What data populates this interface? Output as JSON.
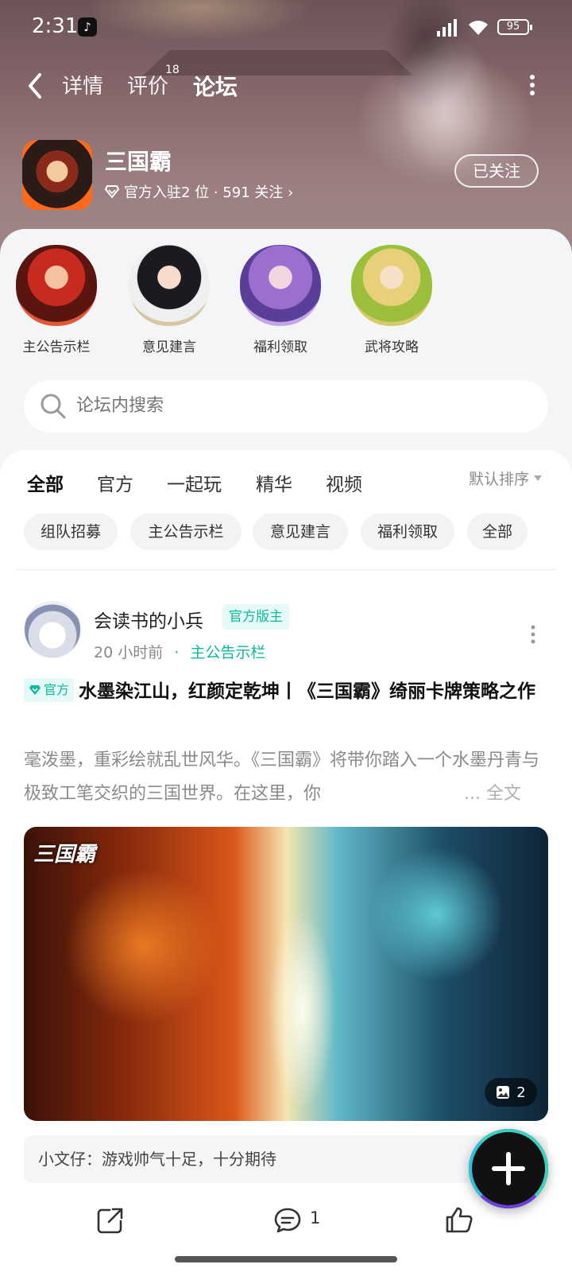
{
  "status_bar": {
    "time": "2:31",
    "battery": "95"
  },
  "nav": {
    "tabs": [
      {
        "label": "详情"
      },
      {
        "label": "评价",
        "badge": "18"
      },
      {
        "label": "论坛"
      }
    ],
    "active_tab": "论坛"
  },
  "game": {
    "title": "三国霸",
    "meta": "官方入驻2 位 · 591 关注 ›",
    "follow_label": "已关注"
  },
  "quick_links": [
    {
      "label": "主公告示栏"
    },
    {
      "label": "意见建言"
    },
    {
      "label": "福利领取"
    },
    {
      "label": "武将攻略"
    }
  ],
  "search": {
    "placeholder": "论坛内搜索"
  },
  "category_tabs": [
    "全部",
    "官方",
    "一起玩",
    "精华",
    "视频"
  ],
  "sort_label": "默认排序",
  "chips": [
    "组队招募",
    "主公告示栏",
    "意见建言",
    "福利领取",
    "全部"
  ],
  "post": {
    "author": "会读书的小兵",
    "author_badge": "官方版主",
    "time": "20 小时前",
    "separator": "·",
    "section": "主公告示栏",
    "official_tag": "官方",
    "title": "水墨染江山，红颜定乾坤丨《三国霸》绮丽卡牌策略之作",
    "excerpt": "毫泼墨，重彩绘就乱世风华。《三国霸》将带你踏入一个水墨丹青与极致工笔交织的三国世界。在这里，你",
    "read_more": "... 全文",
    "image_logo": "三国霸",
    "image_count": "2",
    "top_comment": "小文仔：游戏帅气十足，十分期待",
    "comment_count": "1"
  },
  "colors": {
    "accent": "#19d1b6",
    "accent_text": "#10b89d"
  }
}
